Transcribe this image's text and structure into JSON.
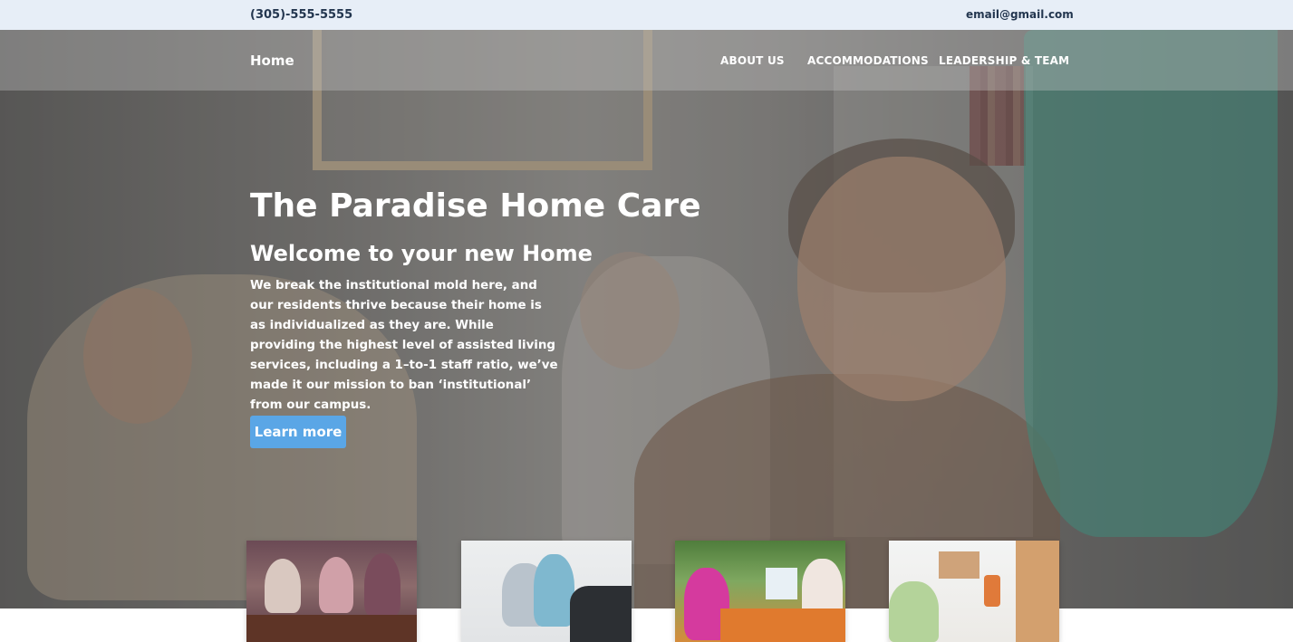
{
  "topbar": {
    "phone": "(305)-555-5555",
    "email": "email@gmail.com"
  },
  "nav": {
    "home": "Home",
    "links": [
      "ABOUT US",
      "ACCOMMODATIONS",
      "LEADERSHIP & TEAM"
    ]
  },
  "hero": {
    "title": "The Paradise Home Care",
    "subtitle": "Welcome to your new Home",
    "body": "We break the institutional mold here, and our residents thrive because their home is as individualized as they are. While providing the highest level of assisted living services, including a 1–to-1 staff ratio, we’ve made it our mission to ban ‘institutional’ from our campus.",
    "cta_label": "Learn more"
  },
  "colors": {
    "topbar_bg": "#e7eef7",
    "topbar_text": "#23364f",
    "cta_bg": "#5aa6e6",
    "text_on_hero": "#ffffff"
  }
}
